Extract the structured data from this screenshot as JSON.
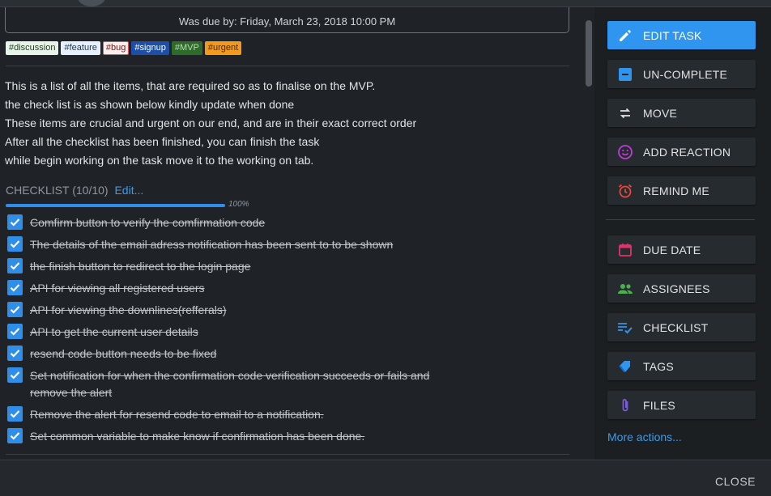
{
  "task": {
    "due_text": "Was due by: Friday, March 23, 2018 10:00 PM",
    "tags": [
      {
        "label": "#discussion",
        "bg": "#e9f4e9",
        "fg": "#1f3b1f",
        "border": "#e9f4e9"
      },
      {
        "label": "#feature",
        "bg": "#e6f0fb",
        "fg": "#1e3450",
        "border": "#e6f0fb"
      },
      {
        "label": "#bug",
        "bg": "#fdecec",
        "fg": "#6a1d1d",
        "border": "#e05252"
      },
      {
        "label": "#signup",
        "bg": "#1f4ea6",
        "fg": "#ffffff",
        "border": "#1f4ea6"
      },
      {
        "label": "#MVP",
        "bg": "#2e6b2a",
        "fg": "#b8d9b2",
        "border": "#2e6b2a"
      },
      {
        "label": "#urgent",
        "bg": "#f39a1d",
        "fg": "#4a2a00",
        "border": "#f39a1d"
      }
    ],
    "description": [
      "This is a list of all the items, that are required so as to finalise on the MVP.",
      "the check list is as shown below kindly update when done",
      "These items are crucial and urgent on our end, and are in their exact correct order",
      "After all the checklist has been finished, you can finish the task",
      "while begin working on the task move it to the working on tab."
    ]
  },
  "checklist": {
    "title": "CHECKLIST (10/10)",
    "edit_label": "Edit...",
    "progress": 1.0,
    "progress_label": "100%",
    "items": [
      "Comfirm button to verify the comfirmation code",
      "The details of the email adress notification has been sent to to be shown",
      "the finish button to redirect to the login page",
      "API for viewing all registered users",
      "API for viewing the downlines(refferals)",
      "API to get the current user details",
      "resend code button needs to be fixed",
      "Set notification for when the confirmation code verification succeeds or fails and remove the alert",
      "Remove the alert for resend code to email to a notification.",
      "Set common variable to make know if confirmation has been done."
    ]
  },
  "actions": {
    "edit_task": "EDIT TASK",
    "uncomplete": "UN-COMPLETE",
    "move": "MOVE",
    "add_reaction": "ADD REACTION",
    "remind_me": "REMIND ME",
    "due_date": "DUE DATE",
    "assignees": "ASSIGNEES",
    "checklist": "CHECKLIST",
    "tags": "TAGS",
    "files": "FILES",
    "more": "More actions..."
  },
  "footer": {
    "close": "CLOSE"
  },
  "colors": {
    "accent": "#2f95ee",
    "reaction_icon": "#c23ad6",
    "remind_icon": "#e8473b",
    "due_date_icon": "#e0346a",
    "assignees_icon": "#4caf50",
    "checklist_icon": "#2f95ee",
    "tags_icon": "#2f95ee",
    "files_icon": "#7b5cd6"
  }
}
